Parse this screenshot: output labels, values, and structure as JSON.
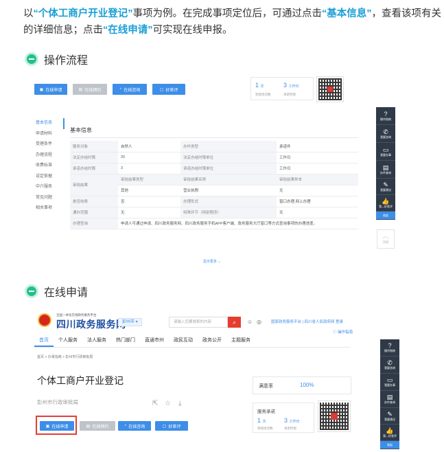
{
  "intro": {
    "p1": "以",
    "hl1": "“个体工商户开业登记”",
    "p2": "事项为例。在完成事项定位后，可通过点击",
    "hl2": "“基本信息”",
    "p3": "，查看该项有关的详细信息；点击",
    "hl3": "“在线申请”",
    "p4": "可实现在线申报。"
  },
  "section1": {
    "title": "操作流程"
  },
  "section2": {
    "title": "在线申请"
  },
  "shot1": {
    "buttons": [
      "在线申请",
      "在线预约",
      "在线咨询",
      "好差评"
    ],
    "stats": [
      {
        "num": "1",
        "unit": "次",
        "label": "到现场次数"
      },
      {
        "num": "3",
        "unit": "工作日",
        "label": "承诺时限"
      }
    ],
    "leftnav": [
      "基本信息",
      "申请材料",
      "受理条件",
      "办理流程",
      "收费标准",
      "设定依据",
      "中介服务",
      "常见问题",
      "相关事项"
    ],
    "info_title": "基本信息",
    "rows": [
      [
        "服务对象",
        "自然人",
        "办件类型",
        "承诺件"
      ],
      [
        "法定办结时限",
        "20",
        "法定办结时限单位",
        "工作日"
      ],
      [
        "承诺办结时限",
        "3",
        "承诺办结时限单位",
        "工作日"
      ]
    ],
    "result_row": {
      "key": "审批结果",
      "h1": "审批结果类型",
      "h2": "审批结果名称",
      "h3": "审批结果样本",
      "v1": "其他",
      "v2": "营业执照",
      "v3": "无"
    },
    "rows2": [
      [
        "是否收费",
        "否",
        "办理形式",
        "窗口办理,网上办理"
      ],
      [
        "通办范围",
        "无",
        "特殊环节（特别程序）",
        "无"
      ]
    ],
    "last_row": {
      "key": "办理查询",
      "value": "申请人可通过申请、四川政务服务网、四川政务服务手机APP客户端、政务服务大厅窗口等方式查询事项的办理进度。"
    },
    "more": "显示更多"
  },
  "rail": {
    "items": [
      "操作指南",
      "我要咨询",
      "我要办事",
      "办件查询",
      "我要建议",
      "我—好差评"
    ],
    "icons": [
      "?",
      "✆",
      "▭",
      "▤",
      "✎",
      "👍"
    ],
    "collapse": "收起"
  },
  "backtop": {
    "label": "顶部"
  },
  "shot2": {
    "logo_sub": "全国一体化在线政务服务平台",
    "logo_main": "四川政务服务网",
    "city": "彭州市",
    "search_placeholder": "请输入您要搜索的内容",
    "toplinks": "国家政务服务平台 | 四川省人民政府网  登录",
    "guide": "操作指南",
    "nav": [
      "首页",
      "个人服务",
      "法人服务",
      "热门部门",
      "直通市州",
      "政民互动",
      "政务公开",
      "主题服务"
    ],
    "crumb": "首页 > 办事指南 > 彭州市行政审批局",
    "item_title": "个体工商户开业登记",
    "dept": "彭州市行政审批局",
    "sat_label": "满意率",
    "sat_value": "100%",
    "promise_label": "服务承诺",
    "buttons": [
      "在线申请",
      "在线预约",
      "在线咨询",
      "好差评"
    ],
    "stats": [
      {
        "num": "1",
        "unit": "次",
        "label": "到现场次数"
      },
      {
        "num": "3",
        "unit": "工作日",
        "label": "承诺时限"
      }
    ]
  },
  "colors": {
    "accent": "#3d8ee8",
    "highlight": "#1a9fd6",
    "green": "#22c08a",
    "red": "#e53d30",
    "rail": "#2f3a48"
  }
}
